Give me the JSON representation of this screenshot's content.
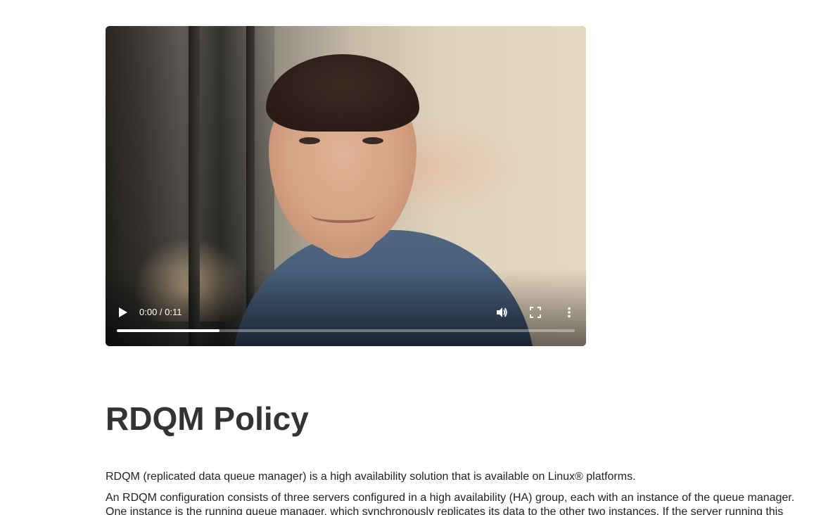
{
  "video": {
    "time_display": "0:00 / 0:11",
    "progress_fraction": 0.225,
    "controls": {
      "play_icon": "play-icon",
      "volume_icon": "volume-icon",
      "fullscreen_icon": "fullscreen-icon",
      "more_icon": "more-options-icon"
    }
  },
  "article": {
    "heading": "RDQM Policy",
    "paragraphs": [
      "RDQM (replicated data queue manager) is a high availability solution that is available on Linux® platforms.",
      "An RDQM configuration consists of three servers configured in a high availability (HA) group, each with an instance of the queue manager. One instance is the running queue manager, which synchronously replicates its data to the other two instances. If the server running this queue manager fails, another instance of the queue manager starts and has current data to operate with."
    ]
  },
  "colors": {
    "heading": "#333333",
    "body_text": "#222222",
    "background": "#ffffff",
    "progress_fill": "#ffffff"
  }
}
